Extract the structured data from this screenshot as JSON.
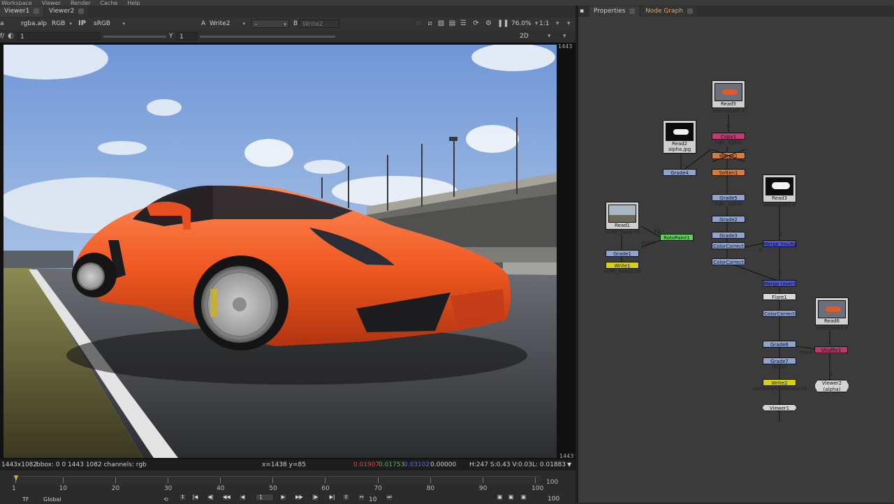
{
  "menu": [
    "Workspace",
    "Viewer",
    "Render",
    "Cache",
    "Help"
  ],
  "viewer_tabs": [
    "Viewer1",
    "Viewer2"
  ],
  "toolbar": {
    "channels": "rgba.alp",
    "rgb": "RGB",
    "lut": "sRGB",
    "a_label": "A",
    "a_input": "Write2",
    "a_op": "-",
    "b_label": "B",
    "b_input": "Write2",
    "zoom": "76.0%",
    "ratio": "1:1",
    "view_mode": "2D",
    "frame_prefix": "f/",
    "gain_value": "1",
    "y_label": "Y",
    "gamma_value": "1"
  },
  "viewer": {
    "edge_top": "1443",
    "edge_bottom": "1443"
  },
  "infobar": {
    "format": "1443x1082",
    "bbox": "bbox: 0 0 1443 1082 channels: rgb",
    "coords": "x=1438 y=85",
    "r": "0.01907",
    "g": "0.01753",
    "b": "0.03102",
    "a": "0.00000",
    "hsv": "H:247 S:0.43 V:0.03",
    "l": "L: 0.01883",
    "colors": {
      "r": "#e04444",
      "g": "#44c144",
      "b": "#5a6cf0"
    }
  },
  "timeline": {
    "ticks": [
      "1",
      "10",
      "20",
      "30",
      "40",
      "50",
      "60",
      "70",
      "80",
      "90",
      "100"
    ],
    "tick_values": [
      1,
      10,
      20,
      30,
      40,
      50,
      60,
      70,
      80,
      90,
      100
    ],
    "current_frame": 1,
    "end_frame": "100",
    "tf": "TF",
    "scope": "Global",
    "frame_field": "1",
    "step": "10",
    "end_field": "100"
  },
  "right_tabs": [
    "Properties",
    "Node Graph"
  ],
  "nodes": {
    "read5": {
      "name": "Read5",
      "file": "lambotest5.e"
    },
    "read2": {
      "name": "Read2",
      "file": "alpha.jpg"
    },
    "read3": {
      "name": "Read3",
      "file": "lambotest2.e"
    },
    "read1": {
      "name": "Read1",
      "file": "HDRI_fixed.hd"
    },
    "read6": {
      "name": "Read6",
      "file": "lambotest4.e"
    },
    "copy1": "Copy1",
    "copy1_sub": "(rgb_alpha)",
    "grade4": "Grade4",
    "merge_node": "Merge1",
    "soften1": "Soften1",
    "grade5": "Grade5",
    "grade5_sub": "(rgb_alpha)",
    "grade2": "Grade2",
    "grade3": "Grade3",
    "colorcorrect1": "ColorCorrect",
    "colorcorrect2": "ColorCorrect",
    "grade1": "Grade1",
    "write1": "Write1",
    "write1_file": "HDRI_fixed2.hd",
    "rotopaint1": "RotoPaint1",
    "merge2": "Merge (multiply)",
    "merge3": "Merge (over)",
    "flare1": "Flare1",
    "colorcorrect3": "ColorCorrect",
    "grade6": "Grade6",
    "shuffle1": "Shuffle1",
    "grade7": "Grade7",
    "grade7_sub": "(blue)",
    "write2": "Write2",
    "write2_file": "LamborghiniRender.tif",
    "viewer2": "Viewer2",
    "viewer2_sub": "(alpha)",
    "viewer1": "Viewer1",
    "pipe_bg": "bg",
    "pipe_mask1": "mask",
    "pipe_mask2": "mask",
    "pipe_a1": "A",
    "pipe_b1": "B",
    "pipe_b2": "B",
    "pipe_a2": "A",
    "pipe_a3": "A",
    "pipe_1a": "1",
    "pipe_1b": "1"
  },
  "colors": {
    "grade": "#8fa3cf",
    "write": "#d6d01a",
    "roto": "#5fcf5f",
    "copy": "#c23a76",
    "merge": "#4a56c9",
    "soften": "#d67b3c",
    "flare": "#d8d8d8",
    "viewer_node": "#d4d4d4",
    "shuffle": "#b83a6a",
    "accent_tab": "#f0a64a"
  }
}
